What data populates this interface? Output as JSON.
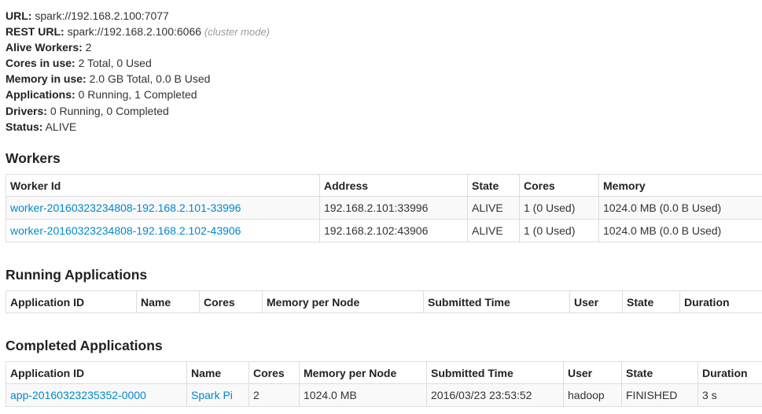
{
  "summary": {
    "url_label": "URL:",
    "url_value": "spark://192.168.2.100:7077",
    "rest_url_label": "REST URL:",
    "rest_url_value": "spark://192.168.2.100:6066",
    "rest_url_note": "(cluster mode)",
    "alive_workers_label": "Alive Workers:",
    "alive_workers_value": "2",
    "cores_label": "Cores in use:",
    "cores_value": "2 Total, 0 Used",
    "memory_label": "Memory in use:",
    "memory_value": "2.0 GB Total, 0.0 B Used",
    "applications_label": "Applications:",
    "applications_value": "0 Running, 1 Completed",
    "drivers_label": "Drivers:",
    "drivers_value": "0 Running, 0 Completed",
    "status_label": "Status:",
    "status_value": "ALIVE"
  },
  "workers": {
    "title": "Workers",
    "columns": [
      "Worker Id",
      "Address",
      "State",
      "Cores",
      "Memory"
    ],
    "rows": [
      {
        "id": "worker-20160323234808-192.168.2.101-33996",
        "address": "192.168.2.101:33996",
        "state": "ALIVE",
        "cores": "1 (0 Used)",
        "memory": "1024.0 MB (0.0 B Used)"
      },
      {
        "id": "worker-20160323234808-192.168.2.102-43906",
        "address": "192.168.2.102:43906",
        "state": "ALIVE",
        "cores": "1 (0 Used)",
        "memory": "1024.0 MB (0.0 B Used)"
      }
    ]
  },
  "running_apps": {
    "title": "Running Applications",
    "columns": [
      "Application ID",
      "Name",
      "Cores",
      "Memory per Node",
      "Submitted Time",
      "User",
      "State",
      "Duration"
    ]
  },
  "completed_apps": {
    "title": "Completed Applications",
    "columns": [
      "Application ID",
      "Name",
      "Cores",
      "Memory per Node",
      "Submitted Time",
      "User",
      "State",
      "Duration"
    ],
    "rows": [
      {
        "id": "app-20160323235352-0000",
        "name": "Spark Pi",
        "cores": "2",
        "memory": "1024.0 MB",
        "submitted": "2016/03/23 23:53:52",
        "user": "hadoop",
        "state": "FINISHED",
        "duration": "3 s"
      }
    ]
  },
  "colors": {
    "link": "#0088cc",
    "text": "#333333",
    "note": "#999999",
    "border": "#dddddd",
    "row_stripe": "#f9f9f9"
  }
}
